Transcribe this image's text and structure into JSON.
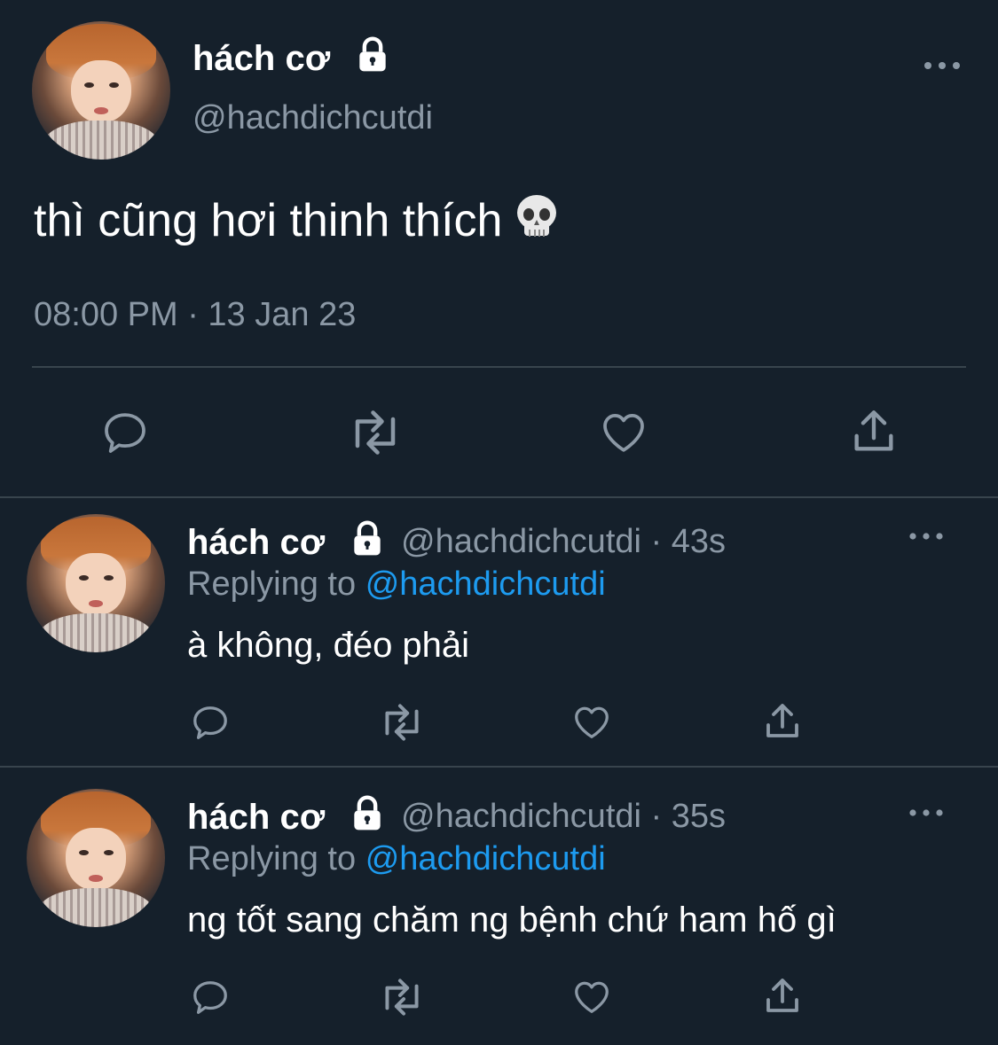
{
  "main_tweet": {
    "author_name": "hách cơ",
    "author_handle": "@hachdichcutdi",
    "text": "thì cũng hơi thinh thích",
    "timestamp": "08:00 PM · 13 Jan 23",
    "locked": true
  },
  "replies": [
    {
      "author_name": "hách cơ",
      "author_handle": "@hachdichcutdi",
      "age": "· 43s",
      "replying_label": "Replying to",
      "replying_to": "@hachdichcutdi",
      "text": "à không, đéo phải"
    },
    {
      "author_name": "hách cơ",
      "author_handle": "@hachdichcutdi",
      "age": "· 35s",
      "replying_label": "Replying to",
      "replying_to": "@hachdichcutdi",
      "text": "ng tốt sang chăm ng bệnh chứ ham hố gì"
    }
  ],
  "icons": {
    "lock": "lock-icon",
    "more": "more-icon",
    "reply": "reply-icon",
    "retweet": "retweet-icon",
    "like": "heart-icon",
    "share": "share-icon",
    "emoji": "skull-emoji"
  },
  "colors": {
    "background": "#15202b",
    "divider": "#38444d",
    "secondary_text": "#8b98a5",
    "mention": "#1d9bf0"
  }
}
